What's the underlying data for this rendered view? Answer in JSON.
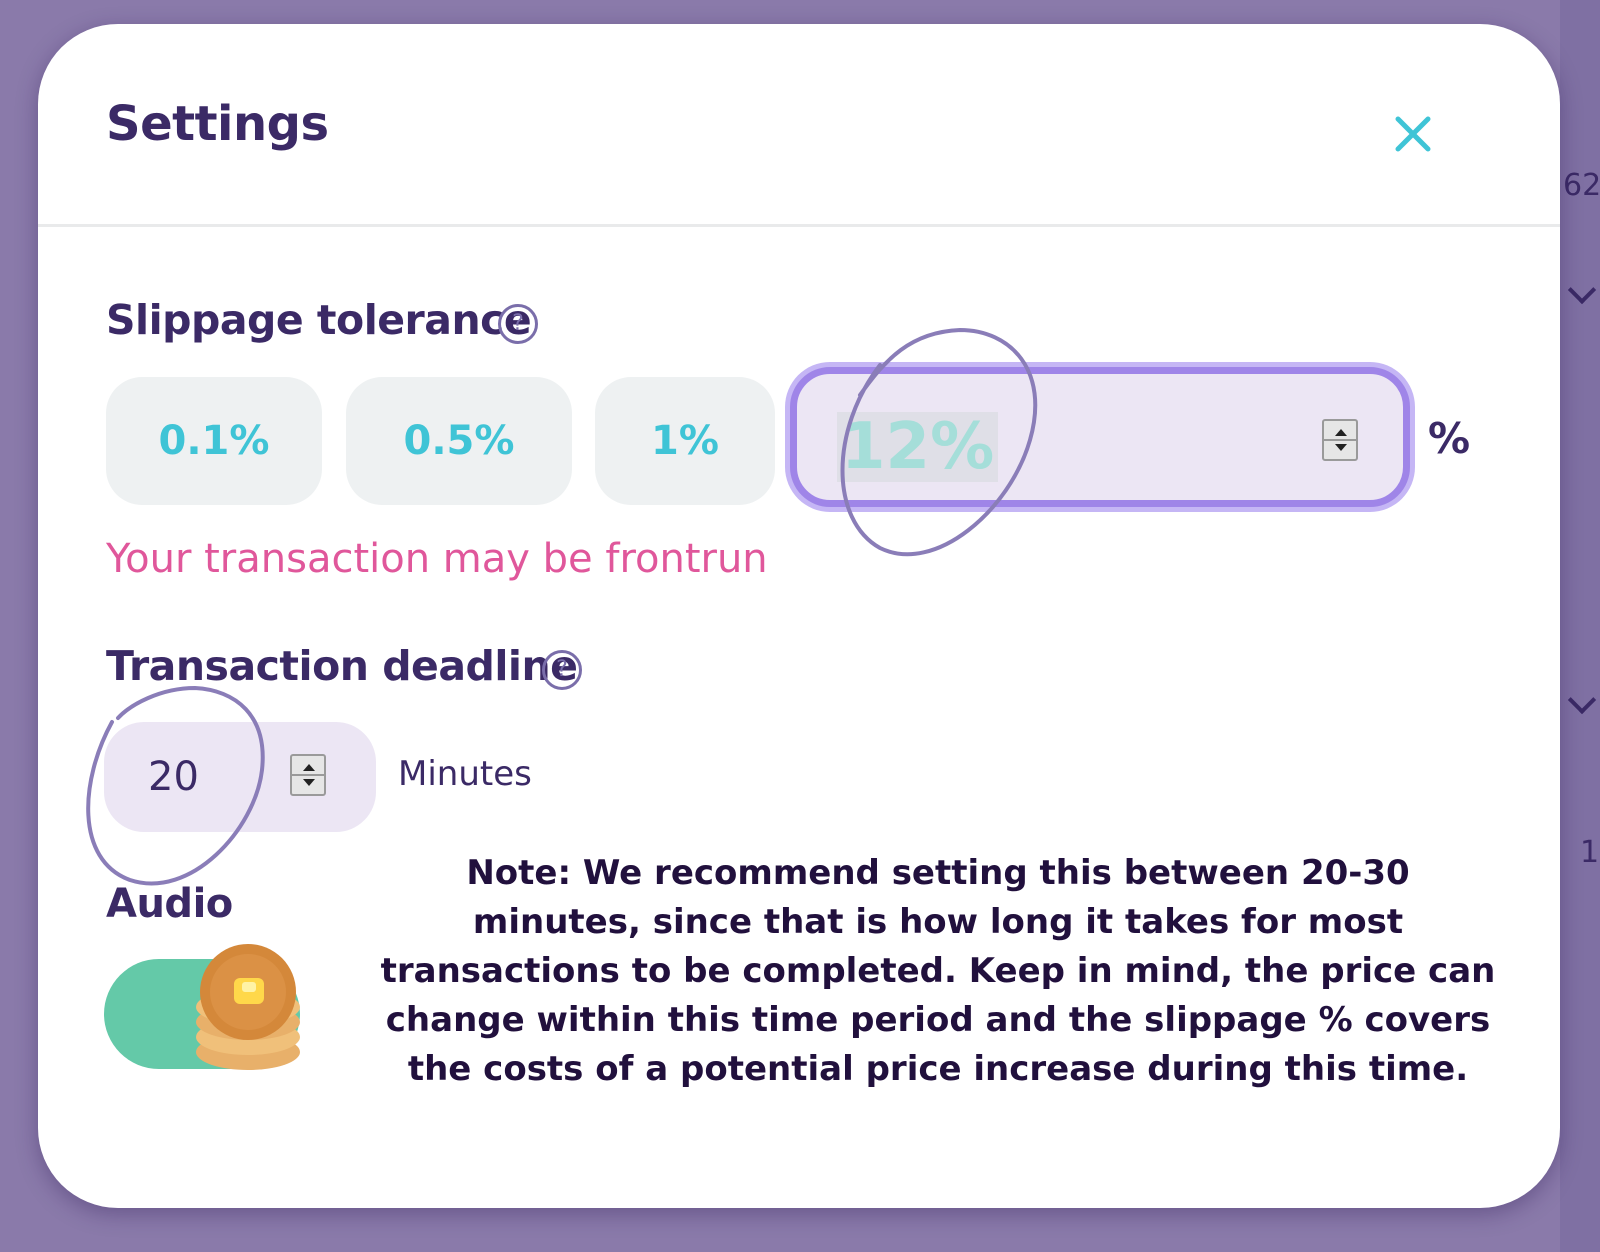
{
  "background": {
    "number_top": "62",
    "number_bottom": "1"
  },
  "modal": {
    "title": "Settings",
    "close_icon": "close-icon"
  },
  "slippage": {
    "label": "Slippage tolerance",
    "help_icon": "question-circle-icon",
    "presets": [
      "0.1%",
      "0.5%",
      "1%"
    ],
    "custom_value": "12%",
    "unit": "%",
    "warning": "Your transaction may be frontrun"
  },
  "deadline": {
    "label": "Transaction deadline",
    "help_icon": "question-circle-icon",
    "value": "20",
    "unit": "Minutes"
  },
  "audio": {
    "label": "Audio",
    "enabled": true,
    "knob_icon": "pancake-stack-icon"
  },
  "note": "Note: We recommend setting this between 20-30 minutes, since that is how long it takes for most transactions to be completed. Keep in mind, the price can change within this time period and the slippage % covers the costs of a potential price increase during this time.",
  "colors": {
    "accent": "#3fc4d6",
    "text": "#3b2a66",
    "warning": "#e0579b",
    "focus_border": "#9f85e8",
    "toggle_on": "#64c9a8",
    "annotation": "#8a7db8"
  }
}
